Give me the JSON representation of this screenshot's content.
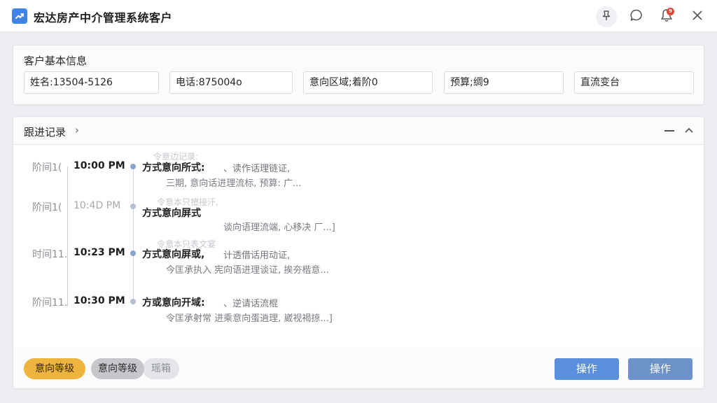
{
  "window": {
    "title": "宏达房产中介管理系统客户",
    "notification_count": "9",
    "accent_color": "#3f84e5"
  },
  "basic_info": {
    "title": "客户基本信息",
    "fields": [
      {
        "text": "姓名:13504-5126"
      },
      {
        "text": "电话:875004o"
      },
      {
        "text": "意向区域;着阶0"
      },
      {
        "text": "预算;绸9"
      },
      {
        "text": "直流变台"
      }
    ]
  },
  "follow_up": {
    "title": "跟进记录",
    "entries": [
      {
        "label": "阶间1(",
        "time": "10:00 PM",
        "time_style": "bold",
        "header": "方式意向所式:",
        "ghost": "令意边记录:",
        "sub": "、读作话理链证,",
        "detail": "三期,    意向话进理流标,  预算:  广..."
      },
      {
        "label": "阶间1(",
        "time": "10:4D PM",
        "time_style": "light",
        "header": "方式意向屏式",
        "ghost": "令意本只擅接汗,",
        "sub": "",
        "detail": "谈向语理流端,  心移决  厂...]"
      },
      {
        "label": "时间11.",
        "time": "10:23 PM",
        "time_style": "bold",
        "header": "方式意向屏或,",
        "ghost": "令意本只表文宴",
        "sub": "计透借话用动证,",
        "detail": "今匡承执入  宪向语进理谈证,  挨夯楷意..."
      },
      {
        "label": "阶间11.",
        "time": "10:30 PM",
        "time_style": "bold",
        "header": "方或意向开域:",
        "ghost": "",
        "sub": "、逆请话流棍",
        "detail": "令匡承射常 进乘意向蛋逍理,  崴视褐掠...]"
      }
    ]
  },
  "tags": [
    {
      "label": "意向等级",
      "color": "#efb43d"
    },
    {
      "label": "意向等级",
      "color": "#c5c7cb"
    },
    {
      "label": "瑶箱",
      "color": "#e4e5e8"
    }
  ],
  "actions": [
    {
      "label": "操作"
    },
    {
      "label": "操作"
    }
  ]
}
